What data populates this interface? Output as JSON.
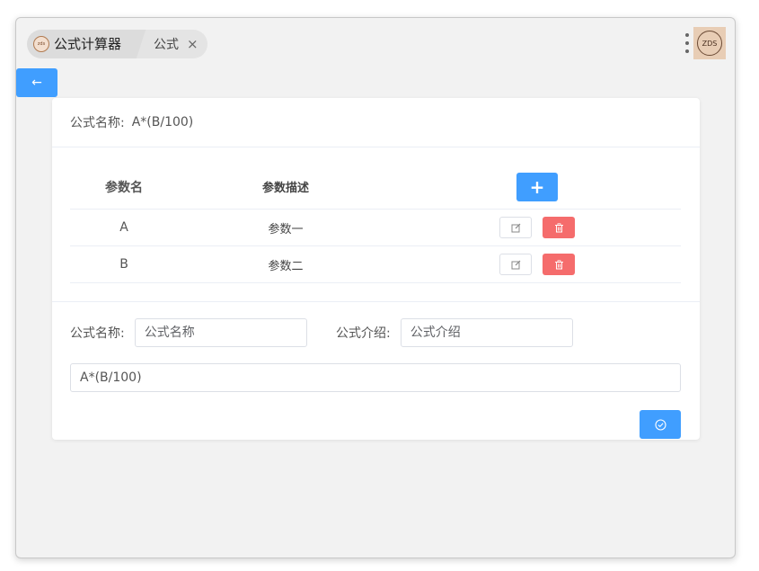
{
  "tabs": {
    "app_label": "公式计算器",
    "logo_text": "zds",
    "doc_label": "公式",
    "close_glyph": "×"
  },
  "header_bar": {
    "avatar_text": "ZDS"
  },
  "back_button": {
    "icon": "arrow-left-icon",
    "glyph": "←"
  },
  "formula_header": {
    "label": "公式名称:",
    "value": "A*(B/100)"
  },
  "params_table": {
    "columns": [
      "参数名",
      "参数描述"
    ],
    "add_glyph": "+",
    "rows": [
      {
        "name": "A",
        "description": "参数一"
      },
      {
        "name": "B",
        "description": "参数二"
      }
    ]
  },
  "form": {
    "name_label": "公式名称:",
    "name_placeholder": "公式名称",
    "intro_label": "公式介绍:",
    "intro_placeholder": "公式介绍",
    "formula_value": "A*(B/100)"
  },
  "colors": {
    "primary": "#409eff",
    "danger": "#f56c6c",
    "background": "#f2f2f2"
  }
}
